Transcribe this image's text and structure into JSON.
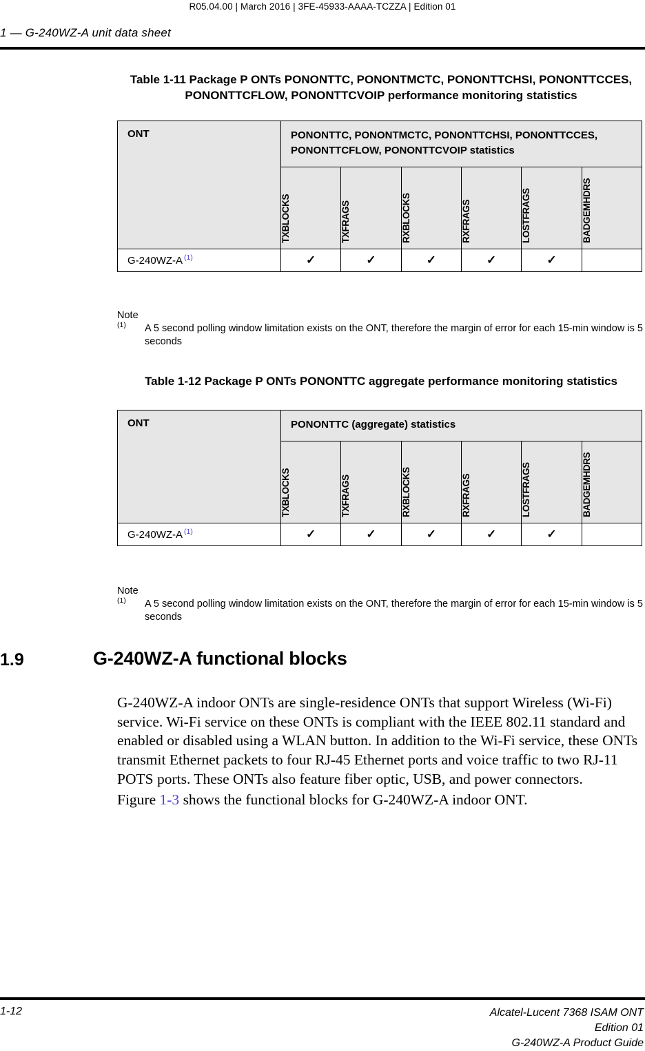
{
  "header": {
    "revision_line": "R05.04.00 | March 2016 | 3FE-45933-AAAA-TCZZA | Edition 01",
    "chapter_line": "1 —  G-240WZ-A unit data sheet"
  },
  "tables": [
    {
      "caption": "Table 1-11 Package P ONTs PONONTTC, PONONTMCTC, PONONTTCHSI, PONONTTCCES, PONONTTCFLOW, PONONTTCVOIP performance monitoring statistics",
      "ont_header": "ONT",
      "stats_header": "PONONTTC, PONONTMCTC, PONONTTCHSI, PONONTTCCES, PONONTTCFLOW, PONONTTCVOIP statistics",
      "columns": [
        "TXBLOCKS",
        "TXFRAGS",
        "RXBLOCKS",
        "RXFRAGS",
        "LOSTFRAGS",
        "BADGEMHDRS"
      ],
      "rows": [
        {
          "name": "G-240WZ-A",
          "footnote": "(1)",
          "values": [
            "✓",
            "✓",
            "✓",
            "✓",
            "✓",
            ""
          ]
        }
      ],
      "note": {
        "title": "Note",
        "marker": "(1)",
        "text": "A 5 second polling window limitation exists on the ONT, therefore the margin of error for each 15-min window is 5 seconds"
      }
    },
    {
      "caption": "Table 1-12 Package P ONTs PONONTTC aggregate performance monitoring statistics",
      "ont_header": "ONT",
      "stats_header": "PONONTTC (aggregate) statistics",
      "columns": [
        "TXBLOCKS",
        "TXFRAGS",
        "RXBLOCKS",
        "RXFRAGS",
        "LOSTFRAGS",
        "BADGEMHDRS"
      ],
      "rows": [
        {
          "name": "G-240WZ-A",
          "footnote": "(1)",
          "values": [
            "✓",
            "✓",
            "✓",
            "✓",
            "✓",
            ""
          ]
        }
      ],
      "note": {
        "title": "Note",
        "marker": "(1)",
        "text": "A 5 second polling window limitation exists on the ONT, therefore the margin of error for each 15-min window is 5 seconds"
      }
    }
  ],
  "section": {
    "number": "1.9",
    "title": "G-240WZ-A functional blocks",
    "paragraph_1": "G-240WZ-A indoor ONTs are single-residence ONTs that support Wireless (Wi-Fi) service. Wi-Fi service on these ONTs is compliant with the IEEE 802.11 standard and enabled or disabled using a WLAN button. In addition to the Wi-Fi service, these ONTs transmit Ethernet packets to four RJ-45 Ethernet ports and voice traffic to two RJ-11 POTS ports. These ONTs also feature fiber optic, USB, and power connectors.",
    "paragraph_2_prefix": "Figure ",
    "paragraph_2_xref": "1-3",
    "paragraph_2_suffix": " shows the functional blocks for G-240WZ-A indoor ONT."
  },
  "footer": {
    "page_number": "1-12",
    "product_line_1": "Alcatel-Lucent 7368 ISAM ONT",
    "product_line_2": "Edition 01",
    "product_line_3": "G-240WZ-A Product Guide"
  },
  "colors": {
    "table_header_fill": "#e6e6e6",
    "xref_link": "#4b3fd6",
    "rule": "#000000"
  }
}
